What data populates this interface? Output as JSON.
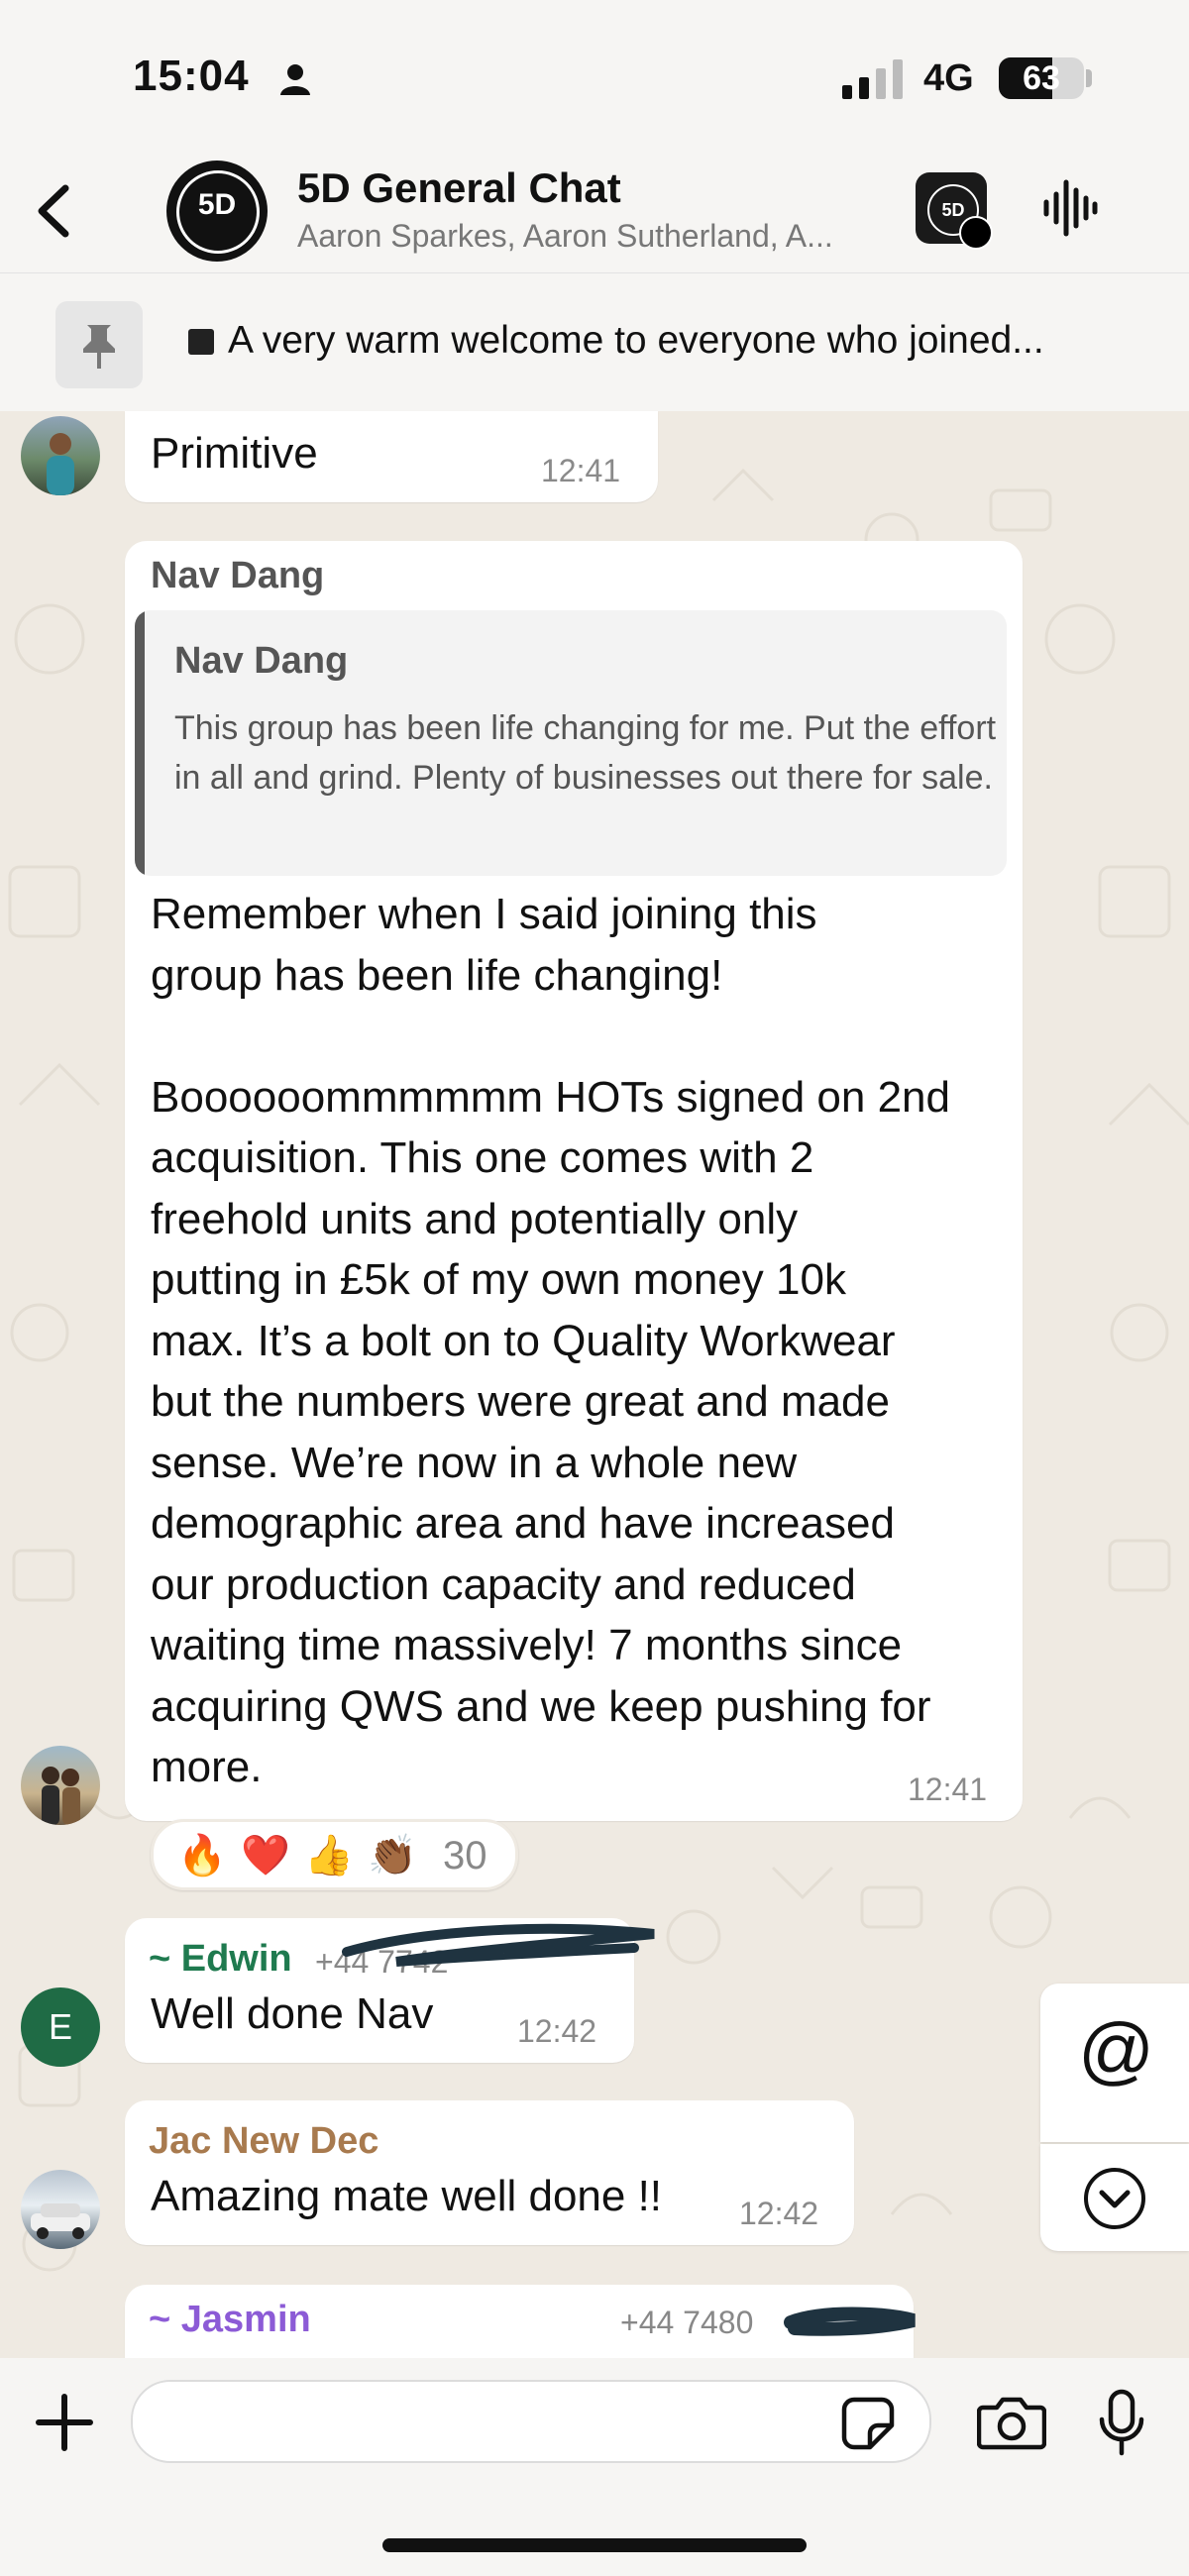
{
  "status_bar": {
    "time": "15:04",
    "network": "4G",
    "battery_percent": "63",
    "battery_level": 0.63
  },
  "header": {
    "back_icon": "chevron-left-icon",
    "avatar_text": "5D",
    "title": "5D General Chat",
    "subtitle": "Aaron Sparkes, Aaron Sutherland, A...",
    "community_icon_text": "5D",
    "voice_icon": "audio-waveform-icon"
  },
  "pinned": {
    "icon": "pin-icon",
    "text": "A very warm welcome to everyone who joined..."
  },
  "messages": {
    "primitive": {
      "text": "Primitive",
      "time": "12:41"
    },
    "nav": {
      "sender": "Nav Dang",
      "quote_sender": "Nav Dang",
      "quote_text": "This group has been life changing for me. Put the effort in all and grind. Plenty of businesses out there for sale.",
      "text": "Remember when I said joining this\ngroup has been life changing!\n\nBoooooommmmmm HOTs signed on 2nd\nacquisition. This one comes with 2\nfreehold units and potentially only\nputting in £5k of my own money 10k\nmax. It’s a bolt on to Quality Workwear\nbut the numbers were great and made\nsense. We’re now in a whole new\ndemographic area and have increased\nour production capacity and reduced\nwaiting time massively! 7 months since\nacquiring QWS and we keep pushing for\nmore.",
      "time": "12:41",
      "reactions": [
        "🔥",
        "❤️",
        "👍",
        "👏🏾"
      ],
      "reaction_count": "30"
    },
    "edwin": {
      "avatar_letter": "E",
      "sender": "~ Edwin",
      "phone": "+44 7742",
      "text": "Well done Nav",
      "time": "12:42"
    },
    "jac": {
      "sender": "Jac New Dec",
      "text": "Amazing mate well done !!",
      "time": "12:42"
    },
    "jasmin": {
      "sender": "~ Jasmin",
      "phone": "+44 7480"
    }
  },
  "side_buttons": {
    "mention_label": "@",
    "scroll_icon": "chevron-down-circle-icon"
  },
  "input_bar": {
    "plus_icon": "plus-icon",
    "sticker_icon": "sticker-icon",
    "camera_icon": "camera-icon",
    "mic_icon": "microphone-icon"
  },
  "colors": {
    "edwin_name": "#1f7a4f",
    "jac_name": "#a87a4e",
    "jasmin_name": "#8c5bd6",
    "edwin_avatar": "#1f6b45",
    "chat_background": "#efeae2"
  }
}
